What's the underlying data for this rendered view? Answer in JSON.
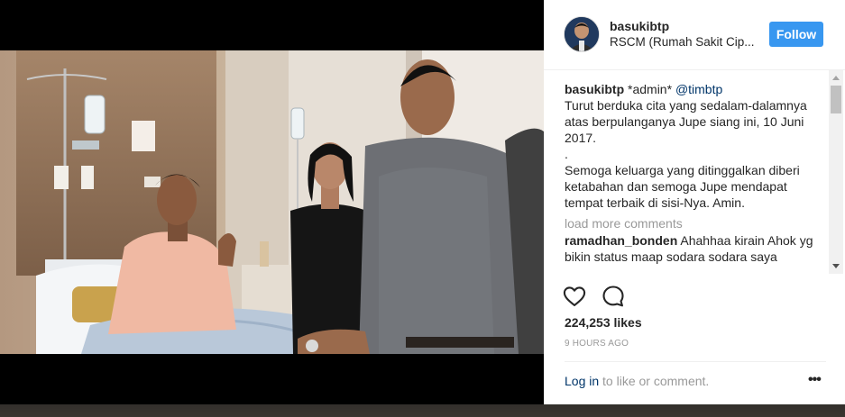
{
  "post": {
    "username": "basukibtp",
    "location": "RSCM (Rumah Sakit Cip...",
    "follow_label": "Follow"
  },
  "caption": {
    "username": "basukibtp",
    "prefix": "*admin*",
    "mention": "@timbtp",
    "lines": [
      "Turut berduka cita yang sedalam-dalamnya",
      "atas berpulanganya Jupe siang ini, 10 Juni",
      "2017.",
      ".",
      "Semoga keluarga yang ditinggalkan diberi",
      "ketabahan dan semoga Jupe mendapat",
      "tempat terbaik di sisi-Nya. Amin."
    ]
  },
  "load_more": "load more comments",
  "comments": [
    {
      "username": "ramadhan_bonden",
      "lines": [
        "Ahahhaa kirain Ahok yg",
        "bikin status maap sodara sodara saya"
      ]
    }
  ],
  "likes": "224,253 likes",
  "timestamp": "9 HOURS AGO",
  "login": {
    "link": "Log in",
    "text": " to like or comment."
  },
  "more_label": "•••",
  "icons": {
    "like": "heart-icon",
    "comment": "comment-icon",
    "more": "more-options-icon"
  },
  "colors": {
    "accent": "#3897f0",
    "link": "#003569",
    "muted": "#999999",
    "text": "#262626"
  }
}
